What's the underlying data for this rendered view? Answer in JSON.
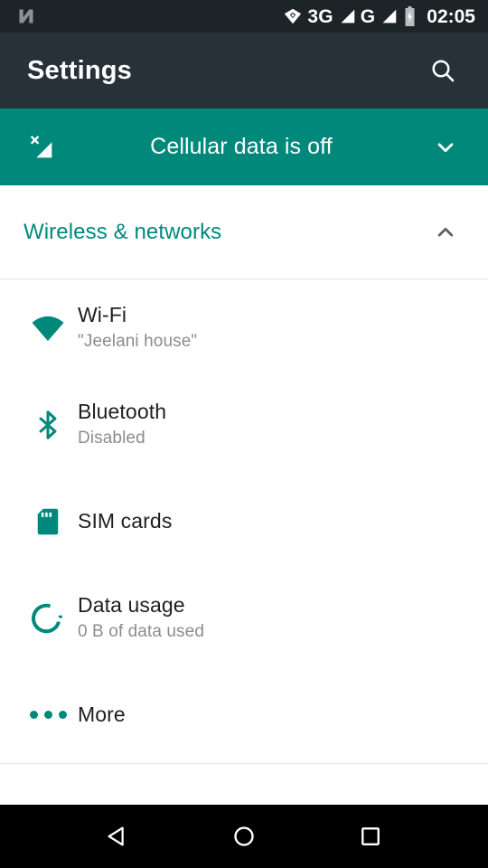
{
  "status_bar": {
    "notification_icon": "android-n-logo-icon",
    "icons": [
      {
        "name": "vibrate-icon",
        "label": ""
      },
      {
        "name": "network-type-3g",
        "label": "3G"
      },
      {
        "name": "signal-bars-icon",
        "label": ""
      },
      {
        "name": "network-type-g",
        "label": "G"
      },
      {
        "name": "signal-bars-icon-2",
        "label": ""
      },
      {
        "name": "battery-charging-icon",
        "label": ""
      }
    ],
    "network_3g": "3G",
    "network_g": "G",
    "time": "02:05"
  },
  "app_bar": {
    "title": "Settings",
    "search_icon": "search-icon"
  },
  "banner": {
    "icon": "signal-off-icon",
    "text": "Cellular data is off",
    "chevron": "chevron-down-icon"
  },
  "section": {
    "title": "Wireless & networks",
    "chevron": "chevron-up-icon"
  },
  "rows": [
    {
      "icon": "wifi-icon",
      "title": "Wi-Fi",
      "subtitle": "\"Jeelani house\""
    },
    {
      "icon": "bluetooth-icon",
      "title": "Bluetooth",
      "subtitle": "Disabled"
    },
    {
      "icon": "sim-card-icon",
      "title": "SIM cards",
      "subtitle": ""
    },
    {
      "icon": "data-usage-icon",
      "title": "Data usage",
      "subtitle": "0 B of data used"
    },
    {
      "icon": "more-dots-icon",
      "title": "More",
      "subtitle": ""
    }
  ],
  "nav_bar": {
    "back": "back-icon",
    "home": "home-icon",
    "recents": "recents-icon"
  },
  "colors": {
    "accent_teal": "#00897b",
    "app_bar": "#263238",
    "status_bar": "#1d2427",
    "title_text": "#1f1f1f",
    "subtitle_text": "#8c8c8c",
    "divider": "#e3e3e3",
    "nav_bar": "#000000"
  }
}
